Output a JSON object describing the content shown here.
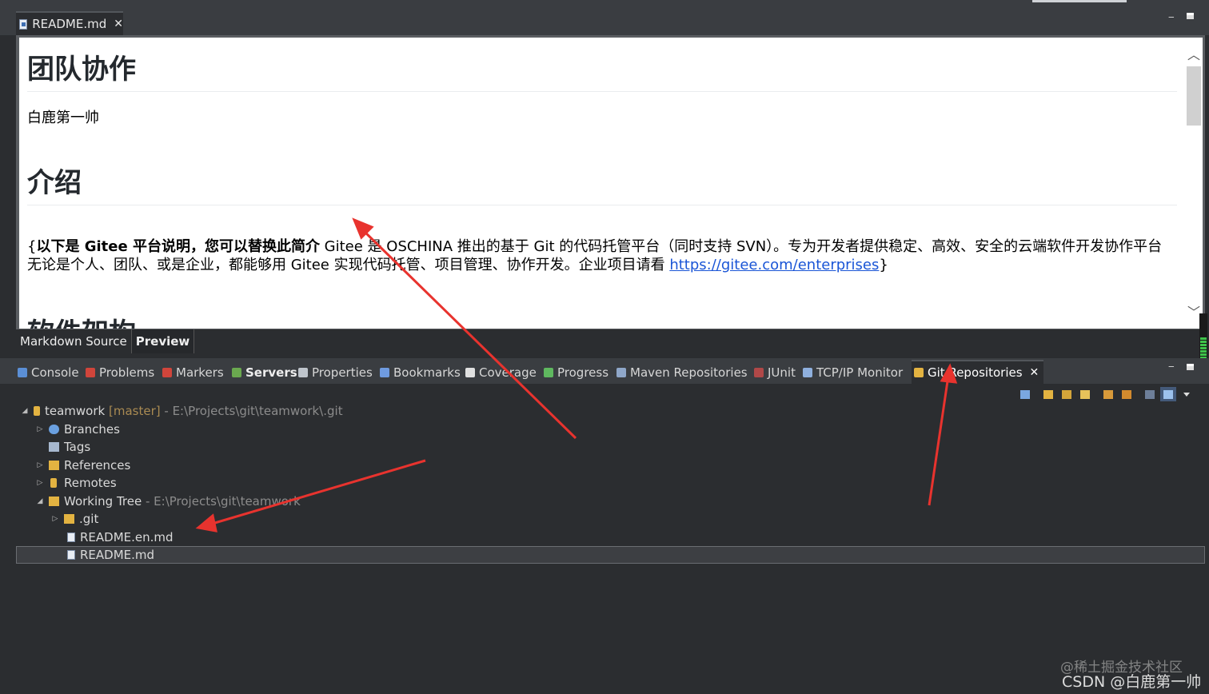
{
  "editor": {
    "tab_label": "README.md",
    "close_glyph": "✕",
    "min_glyph": "‒",
    "doc": {
      "h1_team": "团队协作",
      "para_name": "白鹿第一帅",
      "h1_intro": "介绍",
      "intro_open": "{",
      "intro_bold": "以下是 Gitee 平台说明，您可以替换此简介",
      "intro_text": " Gitee 是 OSCHINA 推出的基于 Git 的代码托管平台（同时支持 SVN）。专为开发者提供稳定、高效、安全的云端软件开发协作平台 无论是个人、团队、或是企业，都能够用 Gitee 实现代码托管、项目管理、协作开发。企业项目请看 ",
      "intro_link": "https://gitee.com/enterprises",
      "intro_close": "}",
      "h1_arch": "软件架构"
    },
    "mode_tabs": [
      {
        "label": "Markdown Source",
        "active": false
      },
      {
        "label": "Preview",
        "active": true
      }
    ],
    "scroll_up": "︿",
    "scroll_down": "﹀"
  },
  "view_tabs": [
    {
      "label": "Console",
      "icon": "console-icon",
      "color": "#5b8fd6"
    },
    {
      "label": "Problems",
      "icon": "problems-icon",
      "color": "#d0453b"
    },
    {
      "label": "Markers",
      "icon": "markers-icon",
      "color": "#d0453b"
    },
    {
      "label": "Servers",
      "icon": "servers-icon",
      "color": "#6aa84f"
    },
    {
      "label": "Properties",
      "icon": "properties-icon",
      "color": "#bfc5cc"
    },
    {
      "label": "Bookmarks",
      "icon": "bookmarks-icon",
      "color": "#6f9be0"
    },
    {
      "label": "Coverage",
      "icon": "coverage-icon",
      "color": "#e0e0e0"
    },
    {
      "label": "Progress",
      "icon": "progress-icon",
      "color": "#5fb85f"
    },
    {
      "label": "Maven Repositories",
      "icon": "maven-icon",
      "color": "#8fa7c9"
    },
    {
      "label": "JUnit",
      "icon": "junit-icon",
      "color": "#b04848"
    },
    {
      "label": "TCP/IP Monitor",
      "icon": "tcpip-icon",
      "color": "#8fb0de"
    },
    {
      "label": "Git Repositories",
      "icon": "git-repositories-icon",
      "color": "#e3b341",
      "active": true
    }
  ],
  "tree": {
    "repo_name": "teamwork",
    "repo_branch": "[master]",
    "repo_path": "- E:\\Projects\\git\\teamwork\\.git",
    "branches": "Branches",
    "tags": "Tags",
    "references": "References",
    "remotes": "Remotes",
    "working_tree": "Working Tree",
    "working_tree_path": "- E:\\Projects\\git\\teamwork",
    "git_folder": ".git",
    "file_en": "README.en.md",
    "file_md": "README.md",
    "expand_open": "◢",
    "expand_closed": "▷"
  },
  "watermark": {
    "line1": "@稀土掘金技术社区",
    "line2": "CSDN @白鹿第一帅"
  },
  "colors": {
    "annotation_arrow": "#e8332e",
    "link": "#1a55d6",
    "branch": "#a98a52"
  }
}
